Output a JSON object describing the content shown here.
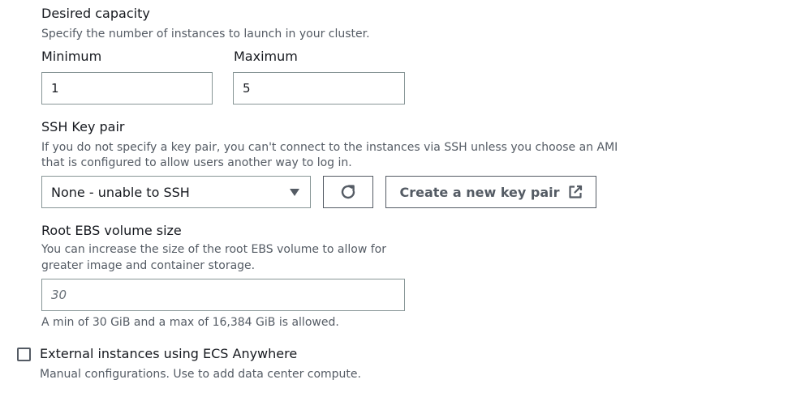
{
  "desired_capacity": {
    "label": "Desired capacity",
    "description": "Specify the number of instances to launch in your cluster.",
    "minimum": {
      "label": "Minimum",
      "value": "1"
    },
    "maximum": {
      "label": "Maximum",
      "value": "5"
    }
  },
  "ssh_key_pair": {
    "label": "SSH Key pair",
    "description_line1": "If you do not specify a key pair, you can't connect to the instances via SSH unless you choose an AMI",
    "description_line2": "that is configured to allow users another way to log in.",
    "selected": "None - unable to SSH",
    "refresh_icon": "refresh-icon",
    "create_button_label": "Create a new key pair",
    "external_icon": "external-link-icon"
  },
  "root_ebs": {
    "label": "Root EBS volume size",
    "description_line1": "You can increase the size of the root EBS volume to allow for",
    "description_line2": "greater image and container storage.",
    "placeholder": "30",
    "constraint": "A min of 30 GiB and a max of 16,384 GiB is allowed."
  },
  "ecs_anywhere": {
    "label": "External instances using ECS Anywhere",
    "description": "Manual configurations. Use to add data center compute.",
    "checked": false
  }
}
